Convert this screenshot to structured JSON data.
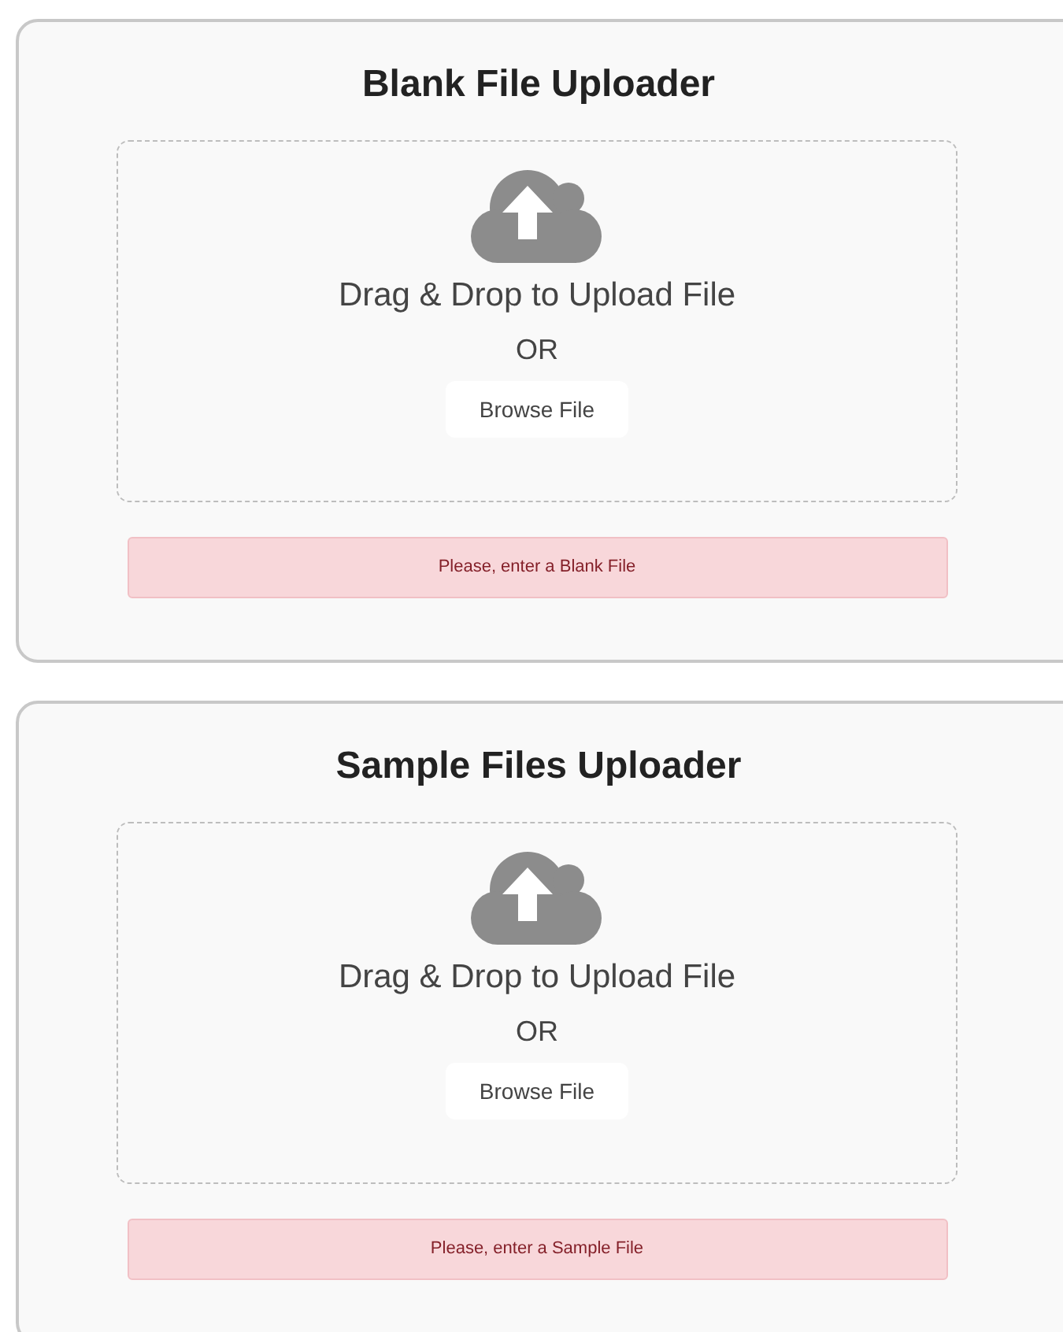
{
  "uploaders": [
    {
      "title": "Blank File Uploader",
      "drop_text": "Drag & Drop to Upload File",
      "or_text": "OR",
      "button": "Browse File",
      "alert": "Please, enter a Blank File"
    },
    {
      "title": "Sample Files Uploader",
      "drop_text": "Drag & Drop to Upload File",
      "or_text": "OR",
      "button": "Browse File",
      "alert": "Please, enter a Sample File"
    }
  ]
}
